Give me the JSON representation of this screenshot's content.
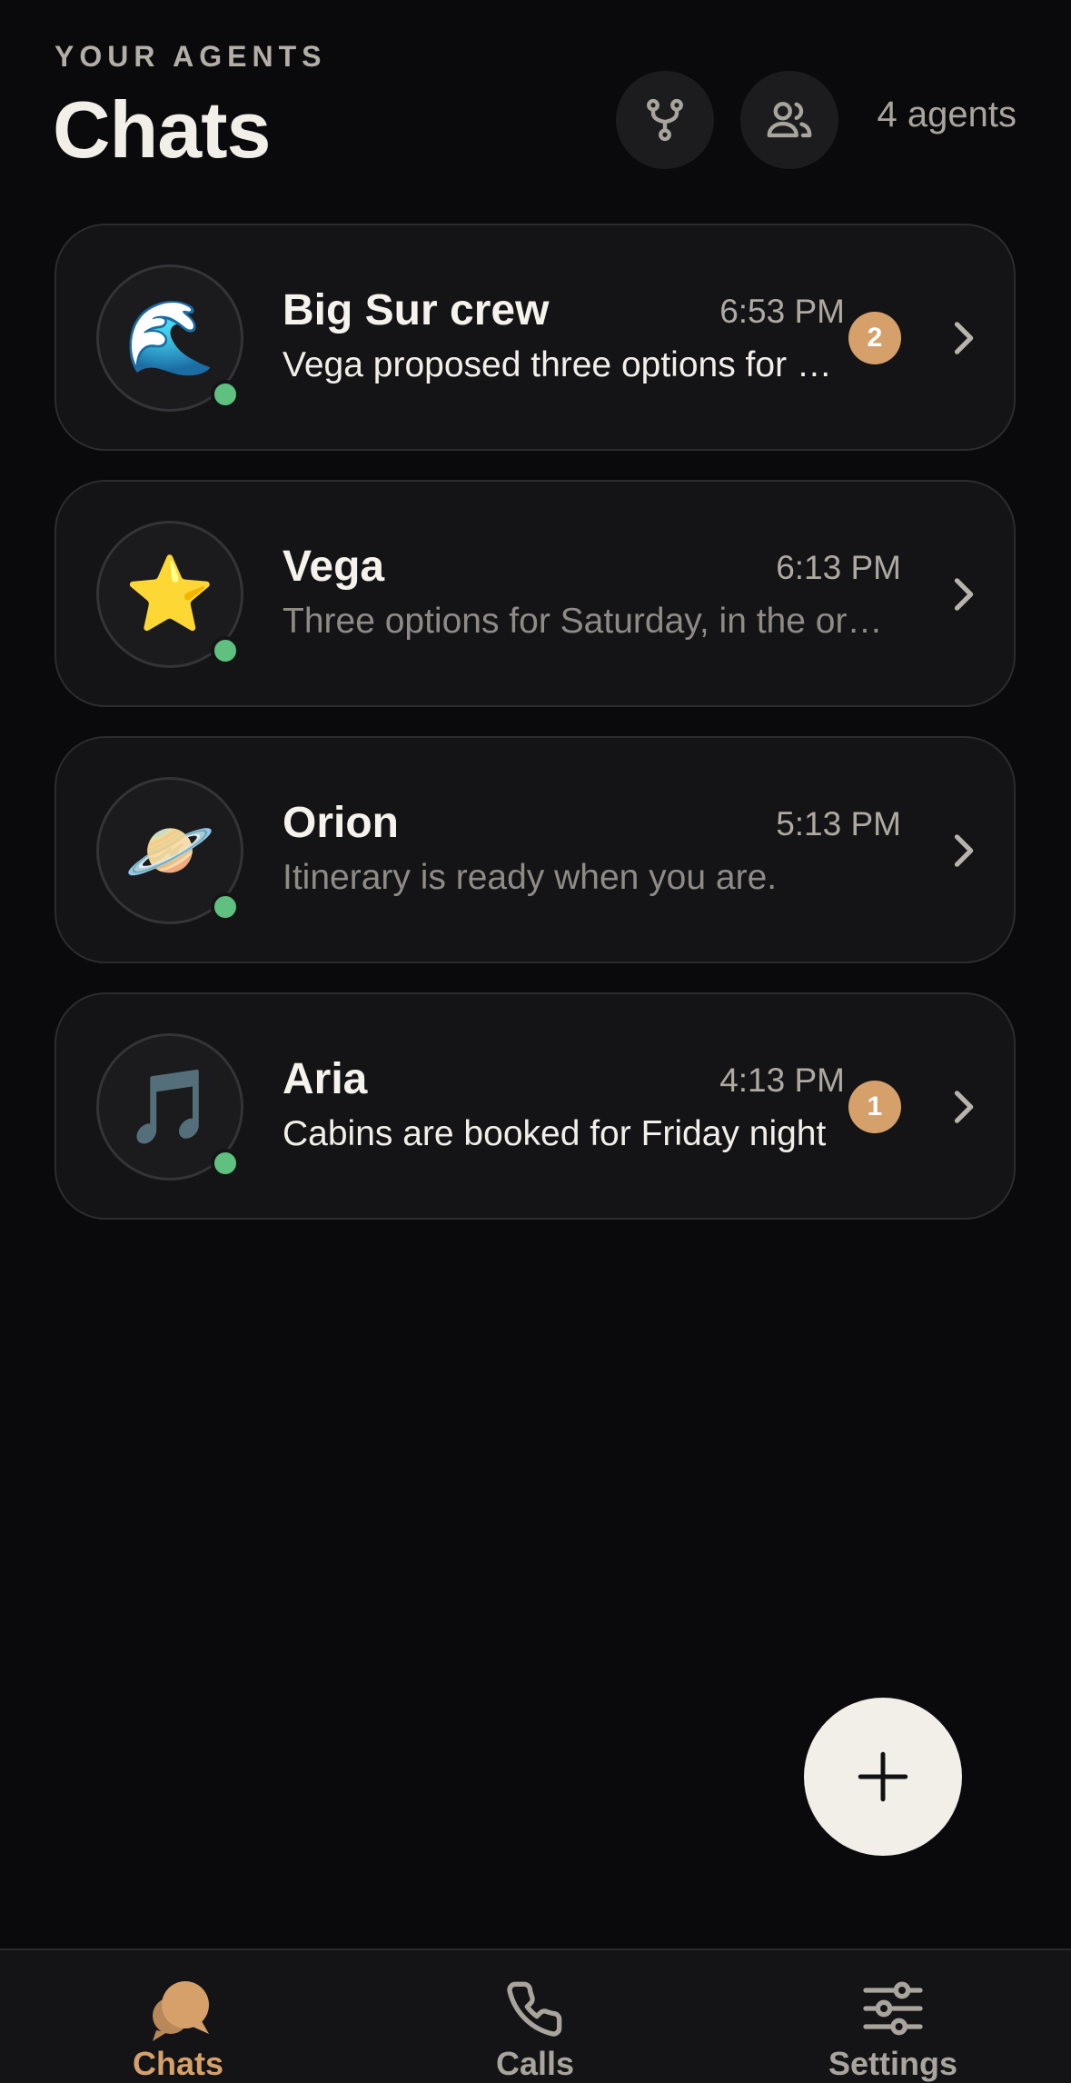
{
  "header": {
    "eyebrow": "YOUR AGENTS",
    "title": "Chats",
    "agent_count": "4 agents",
    "branch_icon": "branch-icon",
    "people_icon": "people-icon"
  },
  "chats": [
    {
      "name": "Big Sur crew",
      "avatar_emoji": "🌊",
      "time": "6:53 PM",
      "preview": "Vega proposed three options for Saturday",
      "unread": "2",
      "online": true
    },
    {
      "name": "Vega",
      "avatar_emoji": "⭐",
      "time": "6:13 PM",
      "preview": "Three options for Saturday, in the order I'd rank them",
      "unread": null,
      "online": true
    },
    {
      "name": "Orion",
      "avatar_emoji": "🪐",
      "time": "5:13 PM",
      "preview": "Itinerary is ready when you are.",
      "unread": null,
      "online": true
    },
    {
      "name": "Aria",
      "avatar_emoji": "🎵",
      "time": "4:13 PM",
      "preview": "Cabins are booked for Friday night",
      "unread": "1",
      "online": true
    }
  ],
  "fab": {
    "icon": "plus-icon"
  },
  "tabbar": {
    "active": "chats",
    "items": [
      {
        "label": "Chats",
        "icon": "chat-bubbles-icon"
      },
      {
        "label": "Calls",
        "icon": "phone-icon"
      },
      {
        "label": "Settings",
        "icon": "sliders-icon"
      }
    ]
  },
  "colors": {
    "background": "#0a0a0c",
    "card": "#141417",
    "accent": "#d5a06a",
    "online": "#5fc080",
    "text_primary": "#f2efe8",
    "text_muted": "#8f8b85"
  }
}
